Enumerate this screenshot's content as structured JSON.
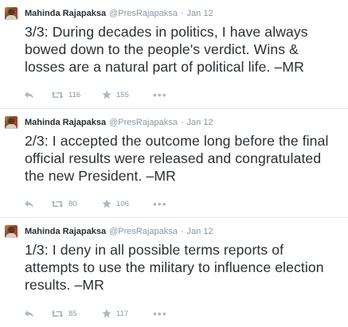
{
  "tweets": [
    {
      "author": "Mahinda Rajapaksa",
      "handle": "@PresRajapaksa",
      "separator": "·",
      "time": "Jan 12",
      "text": "3/3: During decades in politics, I have always bowed down to the people's verdict. Wins & losses are a natural part of political life. –MR",
      "retweets": "116",
      "favorites": "155",
      "more": "•••"
    },
    {
      "author": "Mahinda Rajapaksa",
      "handle": "@PresRajapaksa",
      "separator": "·",
      "time": "Jan 12",
      "text": "2/3: I accepted the outcome long before the final official results were released and congratulated the new President. –MR",
      "retweets": "80",
      "favorites": "106",
      "more": "•••"
    },
    {
      "author": "Mahinda Rajapaksa",
      "handle": "@PresRajapaksa",
      "separator": "·",
      "time": "Jan 12",
      "text": "1/3: I deny in all possible terms reports of attempts to use the military to influence election results. –MR",
      "retweets": "85",
      "favorites": "117",
      "more": "•••"
    }
  ],
  "icons": {
    "reply": "reply-icon",
    "retweet": "retweet-icon",
    "favorite": "star-icon",
    "more": "more-icon"
  },
  "colors": {
    "text": "#292f33",
    "muted": "#8899a6",
    "icon": "#aab8c2",
    "divider": "#e1e8ed"
  }
}
